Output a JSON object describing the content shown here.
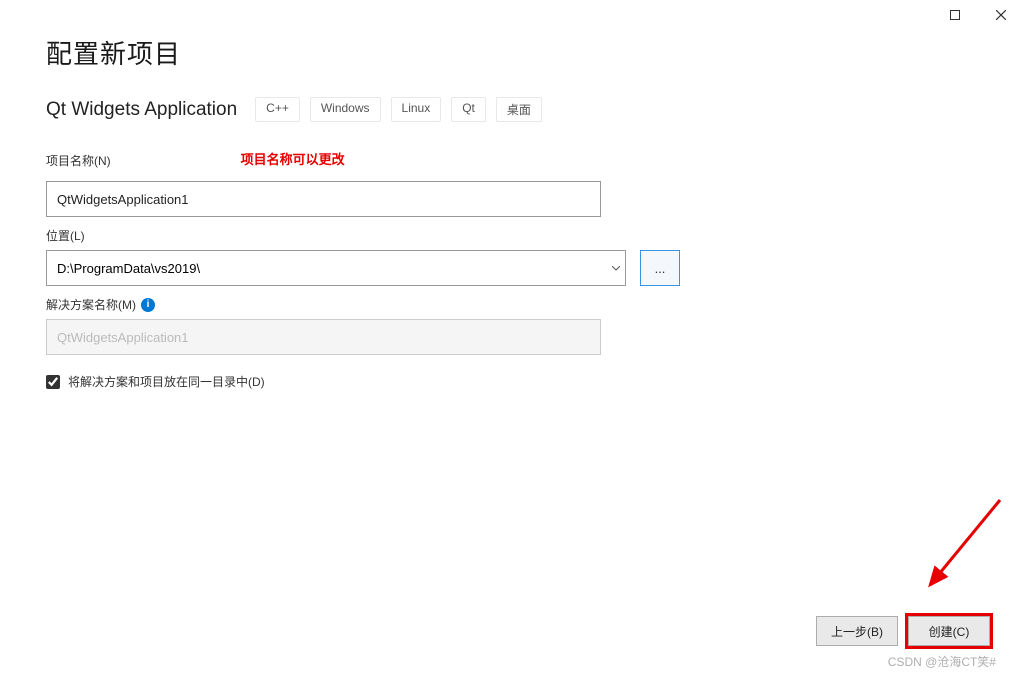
{
  "title": "配置新项目",
  "subtitle": "Qt Widgets Application",
  "tags": [
    "C++",
    "Windows",
    "Linux",
    "Qt",
    "桌面"
  ],
  "project_name": {
    "label": "项目名称(N)",
    "value": "QtWidgetsApplication1",
    "annotation": "项目名称可以更改"
  },
  "location": {
    "label": "位置(L)",
    "value": "D:\\ProgramData\\vs2019\\",
    "browse": "..."
  },
  "solution_name": {
    "label": "解决方案名称(M)",
    "value": "QtWidgetsApplication1"
  },
  "same_dir_checkbox": {
    "label": "将解决方案和项目放在同一目录中(D)",
    "checked": true
  },
  "footer": {
    "back": "上一步(B)",
    "create": "创建(C)"
  },
  "watermark": "CSDN @沧海CT笑# "
}
